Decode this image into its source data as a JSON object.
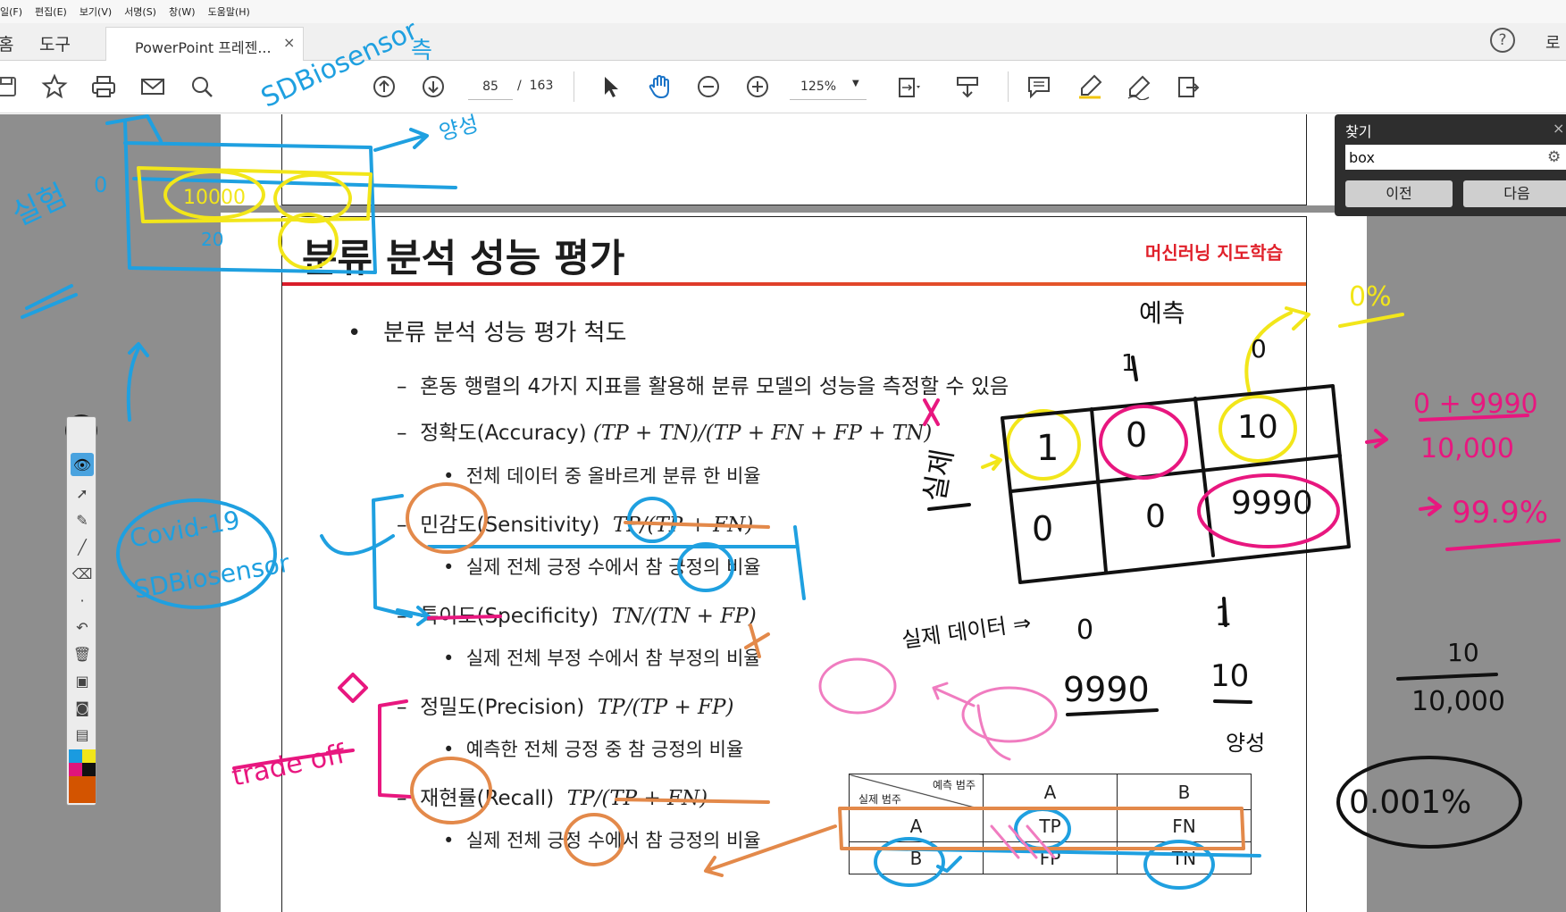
{
  "menu": [
    "일(F)",
    "편집(E)",
    "보기(V)",
    "서명(S)",
    "창(W)",
    "도움말(H)"
  ],
  "tabs": {
    "home": "홈",
    "tools": "도구",
    "document": "PowerPoint 프레젠...",
    "close": "×",
    "help": "?",
    "login": "로"
  },
  "toolbar": {
    "page_current": "85",
    "page_sep": "/",
    "page_total": "163",
    "zoom": "125%"
  },
  "find": {
    "title": "찾기",
    "close": "×",
    "query": "box",
    "prev": "이전",
    "next": "다음"
  },
  "slide": {
    "title": "분류 분석 성능 평가",
    "brand": "머신러닝 지도학습",
    "bullets": [
      {
        "level": 0,
        "text": "분류 분석 성능 평가 척도"
      },
      {
        "level": 1,
        "text": "혼동 행렬의 4가지 지표를 활용해 분류 모델의 성능을 측정할 수 있음"
      },
      {
        "level": 1,
        "text": "정확도(Accuracy)",
        "formula": "(TP + TN)/(TP + FN + FP + TN)"
      },
      {
        "level": 2,
        "text": "전체 데이터 중 올바르게 분류 한 비율"
      },
      {
        "level": 1,
        "text": "민감도(Sensitivity)",
        "formula": "TP/(TP + FN)"
      },
      {
        "level": 2,
        "text": "실제 전체 긍정 수에서 참 긍정의 비율"
      },
      {
        "level": 1,
        "text": "특이도(Specificity)",
        "formula": "TN/(TN + FP)"
      },
      {
        "level": 2,
        "text": "실제 전체 부정 수에서 참 부정의 비율"
      },
      {
        "level": 1,
        "text": "정밀도(Precision)",
        "formula": "TP/(TP + FP)"
      },
      {
        "level": 2,
        "text": "예측한 전체 긍정 중 참 긍정의 비율"
      },
      {
        "level": 1,
        "text": "재현률(Recall)",
        "formula": "TP/(TP + FN)"
      },
      {
        "level": 2,
        "text": "실제 전체 긍정 수에서 참 긍정의 비율"
      }
    ],
    "table": {
      "corner_pred": "예측 범주",
      "corner_actual": "실제 범주",
      "header": [
        "A",
        "B"
      ],
      "rows": [
        [
          "A",
          "TP",
          "FN"
        ],
        [
          "B",
          "FP",
          "TN"
        ]
      ]
    }
  },
  "ink": {
    "colors": {
      "blue": "#1fa0e0",
      "yellow": "#f2e61a",
      "pink": "#e8177f",
      "orange": "#e3894a",
      "black": "#111111",
      "light_pink": "#f07cc0"
    },
    "labels": {
      "sdbiosensor": "SDBiosensor",
      "yangsung": "양성",
      "chuk": "측",
      "num_10000": "10000",
      "num_20": "20",
      "num_0": "0",
      "covid": "Covid-19",
      "trade_off": "trade off",
      "yecheuk": "예측",
      "silje": "실제",
      "zero_pct": "0%",
      "matrix": [
        "1",
        "0",
        "10",
        "0",
        "0",
        "9990"
      ],
      "col_1": "1",
      "col_0": "0",
      "acc_num": "0 + 9990",
      "acc_den": "10,000",
      "acc_result": "99.9%",
      "real_data": "실제 데이터 ⇒",
      "real_0": "0",
      "real_1": "1",
      "real_9990": "9990",
      "real_10": "10",
      "yangsung2": "양성",
      "frac_num": "10",
      "frac_den": "10,000",
      "pct_001": "0.001%"
    }
  }
}
